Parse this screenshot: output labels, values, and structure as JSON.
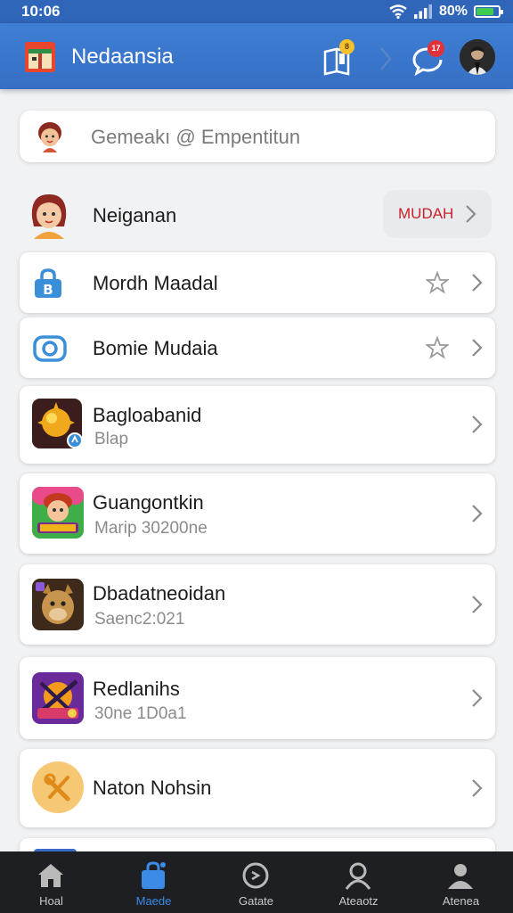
{
  "status_bar": {
    "time": "10:06",
    "battery": "80%",
    "battery_level": 0.8
  },
  "app_bar": {
    "title": "Nedaansia",
    "notification_badge": "8",
    "message_badge": "17"
  },
  "search": {
    "placeholder": "Gemeakı @ Empentitun"
  },
  "profile": {
    "name": "Neiganan",
    "action_label": "MUDAH"
  },
  "settings_items": [
    {
      "title": "Mordh Maadal",
      "icon": "lock-icon"
    },
    {
      "title": "Bomie Mudaia",
      "icon": "camera-icon"
    }
  ],
  "app_items": [
    {
      "title": "Bagloabanid",
      "subtitle": "Blap",
      "icon": "game-sun-icon"
    },
    {
      "title": "Guangontkin",
      "subtitle": "Marip 30200ne",
      "icon": "game-character-icon"
    },
    {
      "title": "Dbadatneoidan",
      "subtitle": "Saenc2:021",
      "icon": "game-creature-icon"
    },
    {
      "title": "Redlanihs",
      "subtitle": "30ne 1D0a1",
      "icon": "game-emblem-icon"
    },
    {
      "title": "Naton Nohsin",
      "icon": "tools-icon"
    }
  ],
  "bottom_nav": [
    {
      "label": "Hoal",
      "icon": "home-icon"
    },
    {
      "label": "Maede",
      "icon": "shopping-bag-icon",
      "active": true
    },
    {
      "label": "Gatate",
      "icon": "compass-icon"
    },
    {
      "label": "Ateaotz",
      "icon": "person-icon"
    },
    {
      "label": "Atenea",
      "icon": "profile-icon"
    }
  ],
  "colors": {
    "app_bar": "#356fc4",
    "accent": "#3b8ae6",
    "badge_red": "#e0323a",
    "nav_bg": "#1e1f22"
  }
}
